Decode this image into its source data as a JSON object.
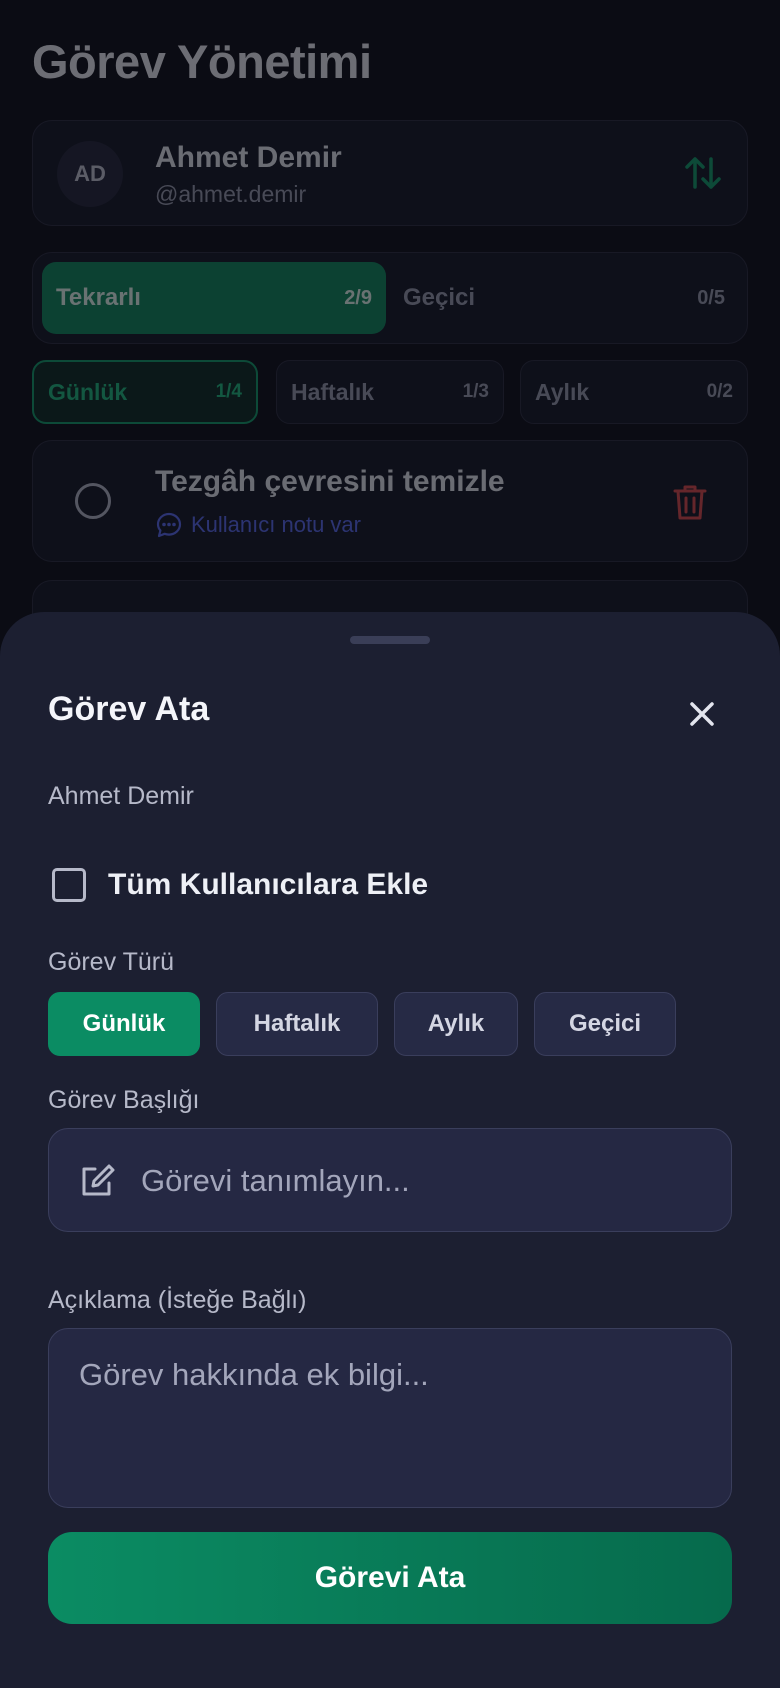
{
  "page": {
    "title": "Görev Yönetimi"
  },
  "user": {
    "initials": "AD",
    "name": "Ahmet Demir",
    "handle": "@ahmet.demir"
  },
  "segments": [
    {
      "label": "Tekrarlı",
      "count": "2/9",
      "active": true
    },
    {
      "label": "Geçici",
      "count": "0/5",
      "active": false
    }
  ],
  "filters": [
    {
      "label": "Günlük",
      "count": "1/4",
      "active": true
    },
    {
      "label": "Haftalık",
      "count": "1/3",
      "active": false
    },
    {
      "label": "Aylık",
      "count": "0/2",
      "active": false
    }
  ],
  "task": {
    "title": "Tezgâh çevresini temizle",
    "note": "Kullanıcı notu var"
  },
  "sheet": {
    "title": "Görev Ata",
    "assignee": "Ahmet Demir",
    "all_users_label": "Tüm Kullanıcılara Ekle",
    "type_label": "Görev Türü",
    "types": [
      "Günlük",
      "Haftalık",
      "Aylık",
      "Geçici"
    ],
    "selected_type": "Günlük",
    "title_label": "Görev Başlığı",
    "title_placeholder": "Görevi tanımlayın...",
    "desc_label": "Açıklama (İsteğe Bağlı)",
    "desc_placeholder": "Görev hakkında ek bilgi...",
    "submit_label": "Görevi Ata"
  },
  "colors": {
    "accent": "#0b8c63",
    "background": "#0b0c14",
    "sheet": "#1c1f31",
    "danger": "#e24b4b",
    "note": "#5b6cf5"
  }
}
